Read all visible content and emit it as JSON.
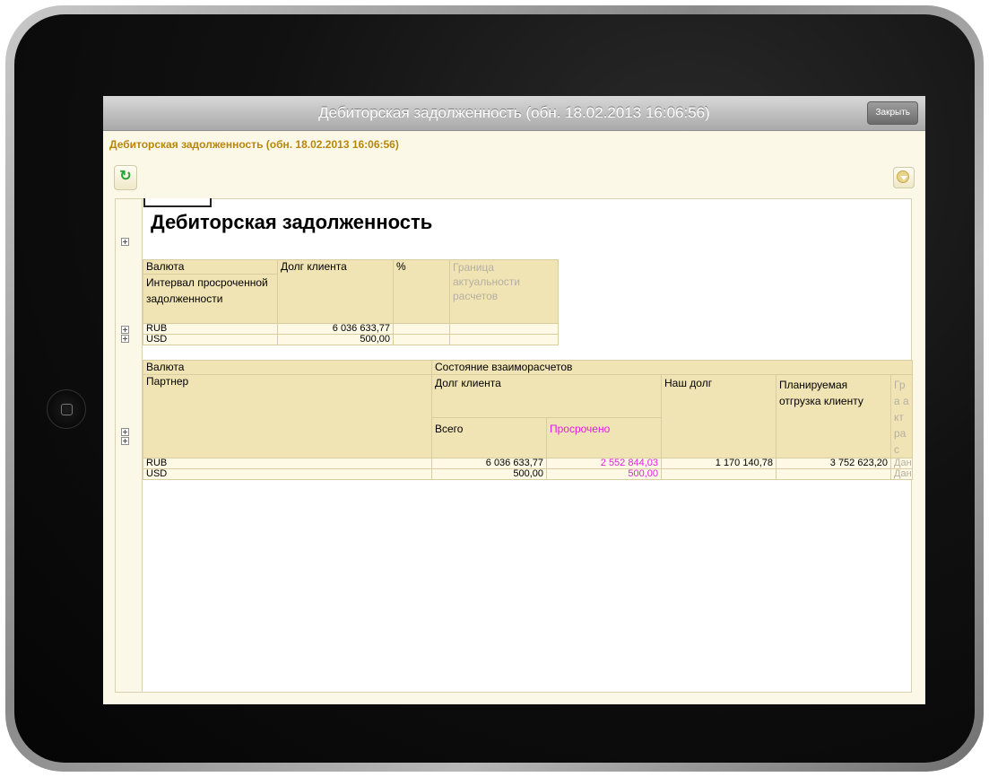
{
  "window": {
    "title": "Дебиторская задолженность (обн. 18.02.2013 16:06:56)",
    "close_label": "Закрыть"
  },
  "form": {
    "caption": "Дебиторская задолженность (обн. 18.02.2013 16:06:56)"
  },
  "report": {
    "title": "Дебиторская задолженность",
    "table1": {
      "headers": {
        "currency": "Валюта",
        "debt": "Долг клиента",
        "percent": "%",
        "boundary": "Граница актуальности расчетов",
        "interval": "Интервал просроченной задолженности"
      },
      "rows": [
        {
          "currency": "RUB",
          "debt": "6 036 633,77"
        },
        {
          "currency": "USD",
          "debt": "500,00"
        }
      ]
    },
    "table2": {
      "headers": {
        "currency": "Валюта",
        "settlements": "Состояние взаиморасчетов",
        "partner": "Партнер",
        "client_debt": "Долг клиента",
        "our_debt": "Наш долг",
        "planned_shipment": "Планируемая отгрузка клиенту",
        "boundary_clip": "Гра акт рас",
        "total": "Всего",
        "overdue": "Просрочено"
      },
      "rows": [
        {
          "currency": "RUB",
          "total": "6 036 633,77",
          "overdue": "2 552 844,03",
          "our_debt": "1 170 140,78",
          "planned": "3 752 623,20",
          "boundary_clip": "Дан"
        },
        {
          "currency": "USD",
          "total": "500,00",
          "overdue": "500,00",
          "our_debt": "",
          "planned": "",
          "boundary_clip": "Дан"
        }
      ]
    }
  },
  "colors": {
    "accent_caption": "#b8860b",
    "header_fill": "#f0e3b4",
    "overdue_text": "#e020e0"
  },
  "icons": [
    "refresh-icon",
    "menu-dropdown-icon",
    "expand-icon",
    "home-button-icon"
  ]
}
